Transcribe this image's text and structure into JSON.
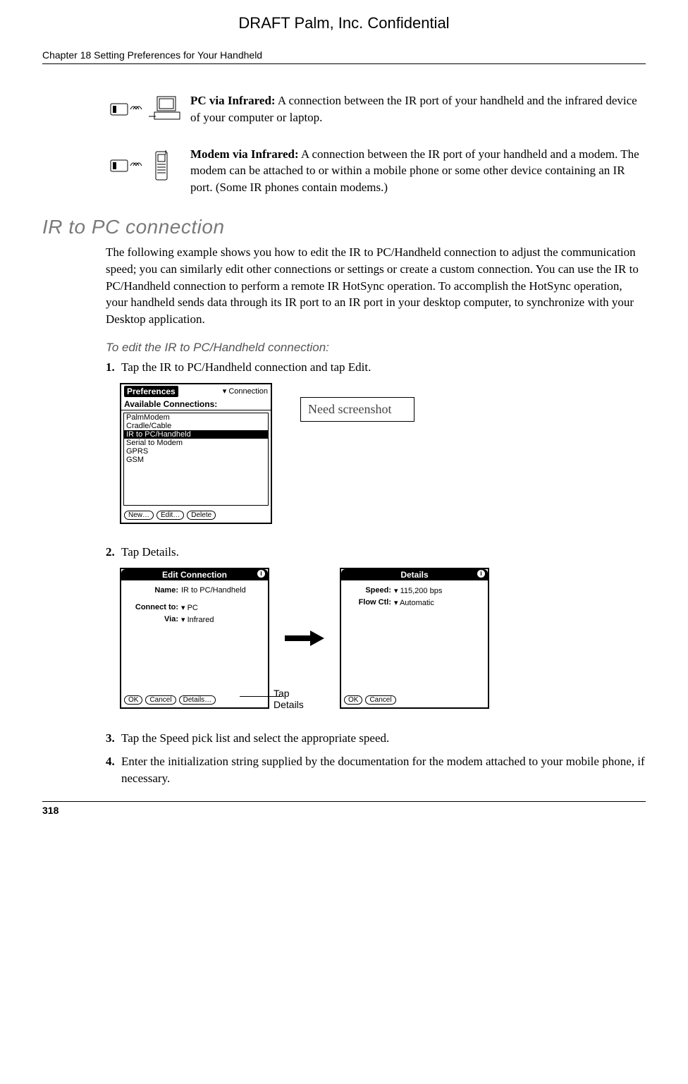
{
  "draft_header": "DRAFT   Palm, Inc. Confidential",
  "chapter_line": "Chapter 18   Setting Preferences for Your Handheld",
  "def1": {
    "label": "PC via Infrared:",
    "text": " A connection between the IR port of your handheld and the infrared device of your computer or laptop."
  },
  "def2": {
    "label": "Modem via Infrared:",
    "text": " A connection between the IR port of your handheld and a modem. The modem can be attached to or within a mobile phone or some other device containing an IR port. (Some IR phones contain modems.)"
  },
  "section_heading": "IR to PC connection",
  "body_para": "The following example shows you how to edit the IR to PC/Handheld connection to adjust the communication speed; you can similarly edit other connections or settings or create a custom connection. You can use the IR to PC/Handheld connection to perform a remote IR HotSync operation. To accomplish the HotSync operation, your handheld sends data through its IR port to an IR port in your desktop computer, to synchronize with your Desktop application.",
  "sub_heading": "To edit the IR to PC/Handheld connection:",
  "steps": {
    "s1": {
      "num": "1.",
      "text": "Tap the IR to PC/Handheld connection and tap Edit."
    },
    "s2": {
      "num": "2.",
      "text": "Tap Details."
    },
    "s3": {
      "num": "3.",
      "text": "Tap the Speed pick list and select the appropriate speed."
    },
    "s4": {
      "num": "4.",
      "text": "Enter the initialization string supplied by the documentation for the modem attached to your mobile phone, if necessary."
    }
  },
  "prefs_shot": {
    "title": "Preferences",
    "dropdown": "▾ Connection",
    "subtitle": "Available Connections:",
    "items": [
      "PalmModem",
      "Cradle/Cable",
      "IR to PC/Handheld",
      "Serial to Modem",
      "GPRS",
      "GSM"
    ],
    "selected_index": 2,
    "buttons": [
      "New…",
      "Edit…",
      "Delete"
    ]
  },
  "need_box": "Need screenshot",
  "edit_shot": {
    "title": "Edit Connection",
    "rows": [
      {
        "label": "Name:",
        "value": "IR to PC/Handheld"
      },
      {
        "label": "Connect to:",
        "value": "▾ PC"
      },
      {
        "label": "Via:",
        "value": "▾ Infrared"
      }
    ],
    "buttons": [
      "OK",
      "Cancel",
      "Details…"
    ]
  },
  "details_shot": {
    "title": "Details",
    "rows": [
      {
        "label": "Speed:",
        "value": "▾ 115,200 bps"
      },
      {
        "label": "Flow Ctl:",
        "value": "▾ Automatic"
      }
    ],
    "buttons": [
      "OK",
      "Cancel"
    ]
  },
  "tap_callout": "Tap\nDetails",
  "page_number": "318"
}
